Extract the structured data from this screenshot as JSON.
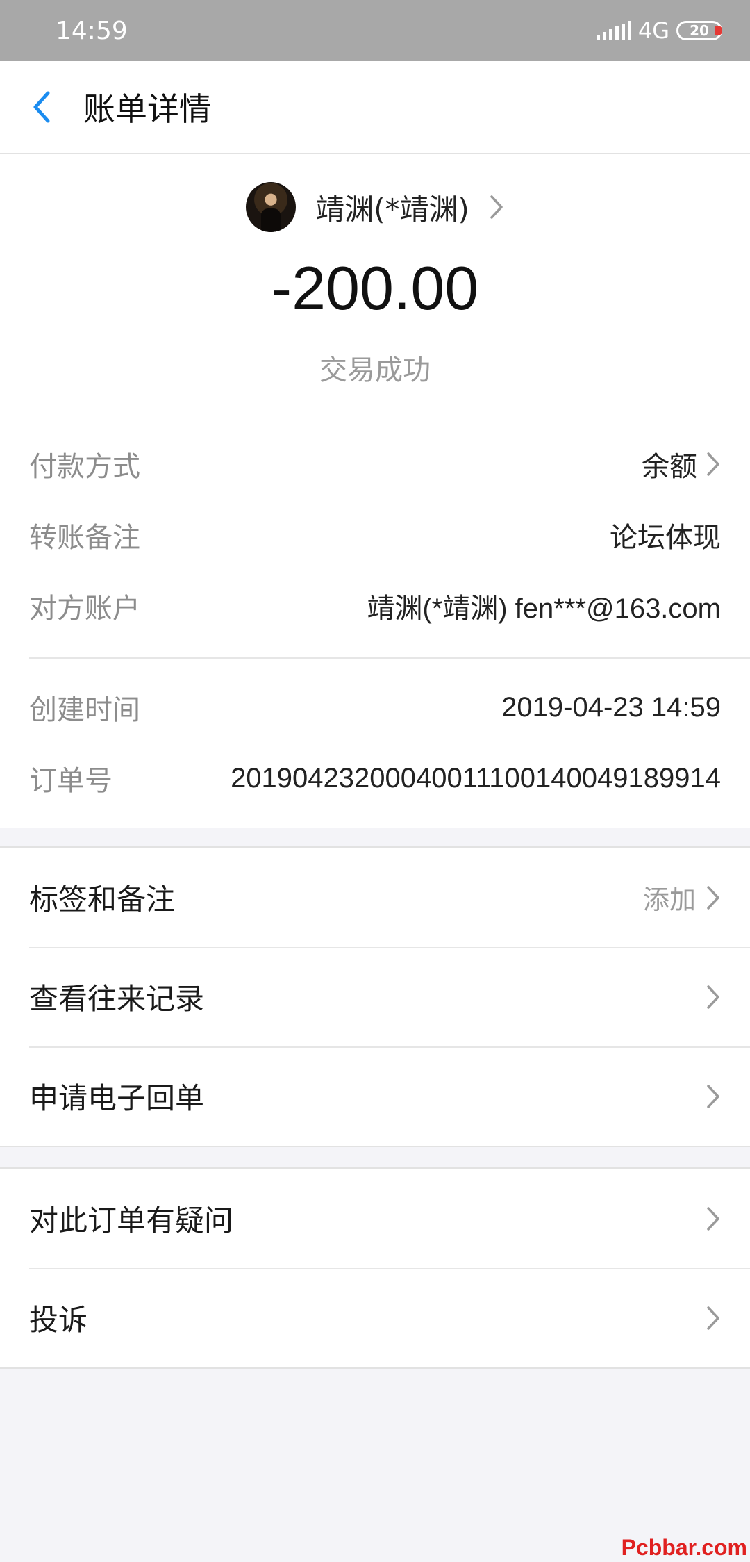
{
  "status_bar": {
    "time": "14:59",
    "network": "4G",
    "battery": "20"
  },
  "header": {
    "title": "账单详情",
    "back_icon": "chevron-left-icon"
  },
  "summary": {
    "payee_name": "靖渊(*靖渊)",
    "amount": "-200.00",
    "status": "交易成功"
  },
  "details": [
    {
      "label": "付款方式",
      "value": "余额"
    },
    {
      "label": "转账备注",
      "value": "论坛体现"
    },
    {
      "label": "对方账户",
      "value": "靖渊(*靖渊) fen***@163.com"
    },
    {
      "label": "创建时间",
      "value": "2019-04-23 14:59"
    },
    {
      "label": "订单号",
      "value": "20190423200040011100140049189914"
    }
  ],
  "menu_group_1": [
    {
      "label": "标签和备注",
      "hint": "添加"
    },
    {
      "label": "查看往来记录"
    },
    {
      "label": "申请电子回单"
    }
  ],
  "menu_group_2": [
    {
      "label": "对此订单有疑问"
    },
    {
      "label": "投诉"
    }
  ],
  "watermark": "Pcbbar.com",
  "colors": {
    "accent": "#1a8cf0",
    "status_bar": "#a8a8a8",
    "background": "#f4f4f8"
  }
}
